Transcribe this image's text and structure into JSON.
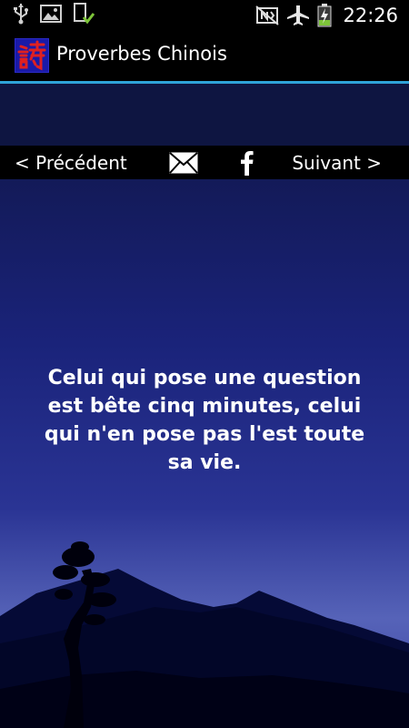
{
  "status_bar": {
    "time": "22:26",
    "icons_left": [
      "usb-icon",
      "image-icon",
      "download-done-icon"
    ],
    "icons_right": [
      "nfc-icon",
      "airplane-icon",
      "battery-charging-icon"
    ]
  },
  "action_bar": {
    "app_icon": "chinese-character-logo-icon",
    "title": "Proverbes Chinois",
    "divider_color": "#2fa3d8"
  },
  "nav": {
    "previous_label": "< Précédent",
    "next_label": "Suivant >",
    "share_icons": [
      "mail-icon",
      "facebook-icon"
    ]
  },
  "proverb": {
    "text": "Celui qui pose une question est bête cinq minutes, celui qui n'en pose pas l'est toute sa vie."
  },
  "colors": {
    "ad_background": "#0e1541",
    "content_top": "#131a58",
    "content_bottom": "#2a3390",
    "mountain": "#000025"
  }
}
